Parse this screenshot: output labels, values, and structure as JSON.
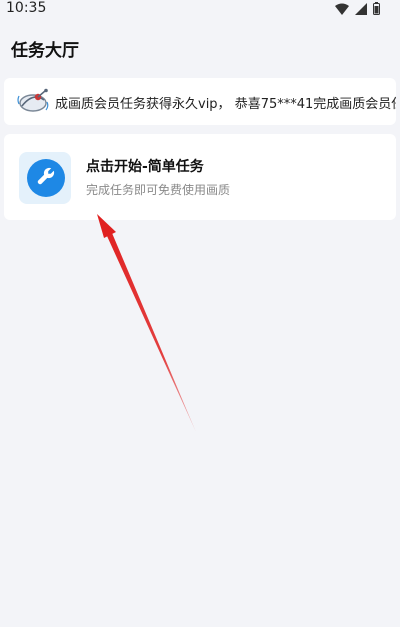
{
  "status_bar": {
    "time": "10:35",
    "icons": [
      "wifi-icon",
      "signal-icon",
      "battery-icon"
    ]
  },
  "header": {
    "title": "任务大厅"
  },
  "notice": {
    "icon": "satellite-announcement-icon",
    "text": "成画质会员任务获得永久vip， 恭喜75***41完成画质会员任"
  },
  "tasks": [
    {
      "icon": "wrench-icon",
      "title": "点击开始-简单任务",
      "subtitle": "完成任务即可免费使用画质"
    }
  ],
  "colors": {
    "background": "#f3f4f8",
    "card": "#ffffff",
    "accent_blue": "#1e88e5",
    "icon_tile": "#e4f1fb",
    "annotation_arrow": "#e02020"
  }
}
